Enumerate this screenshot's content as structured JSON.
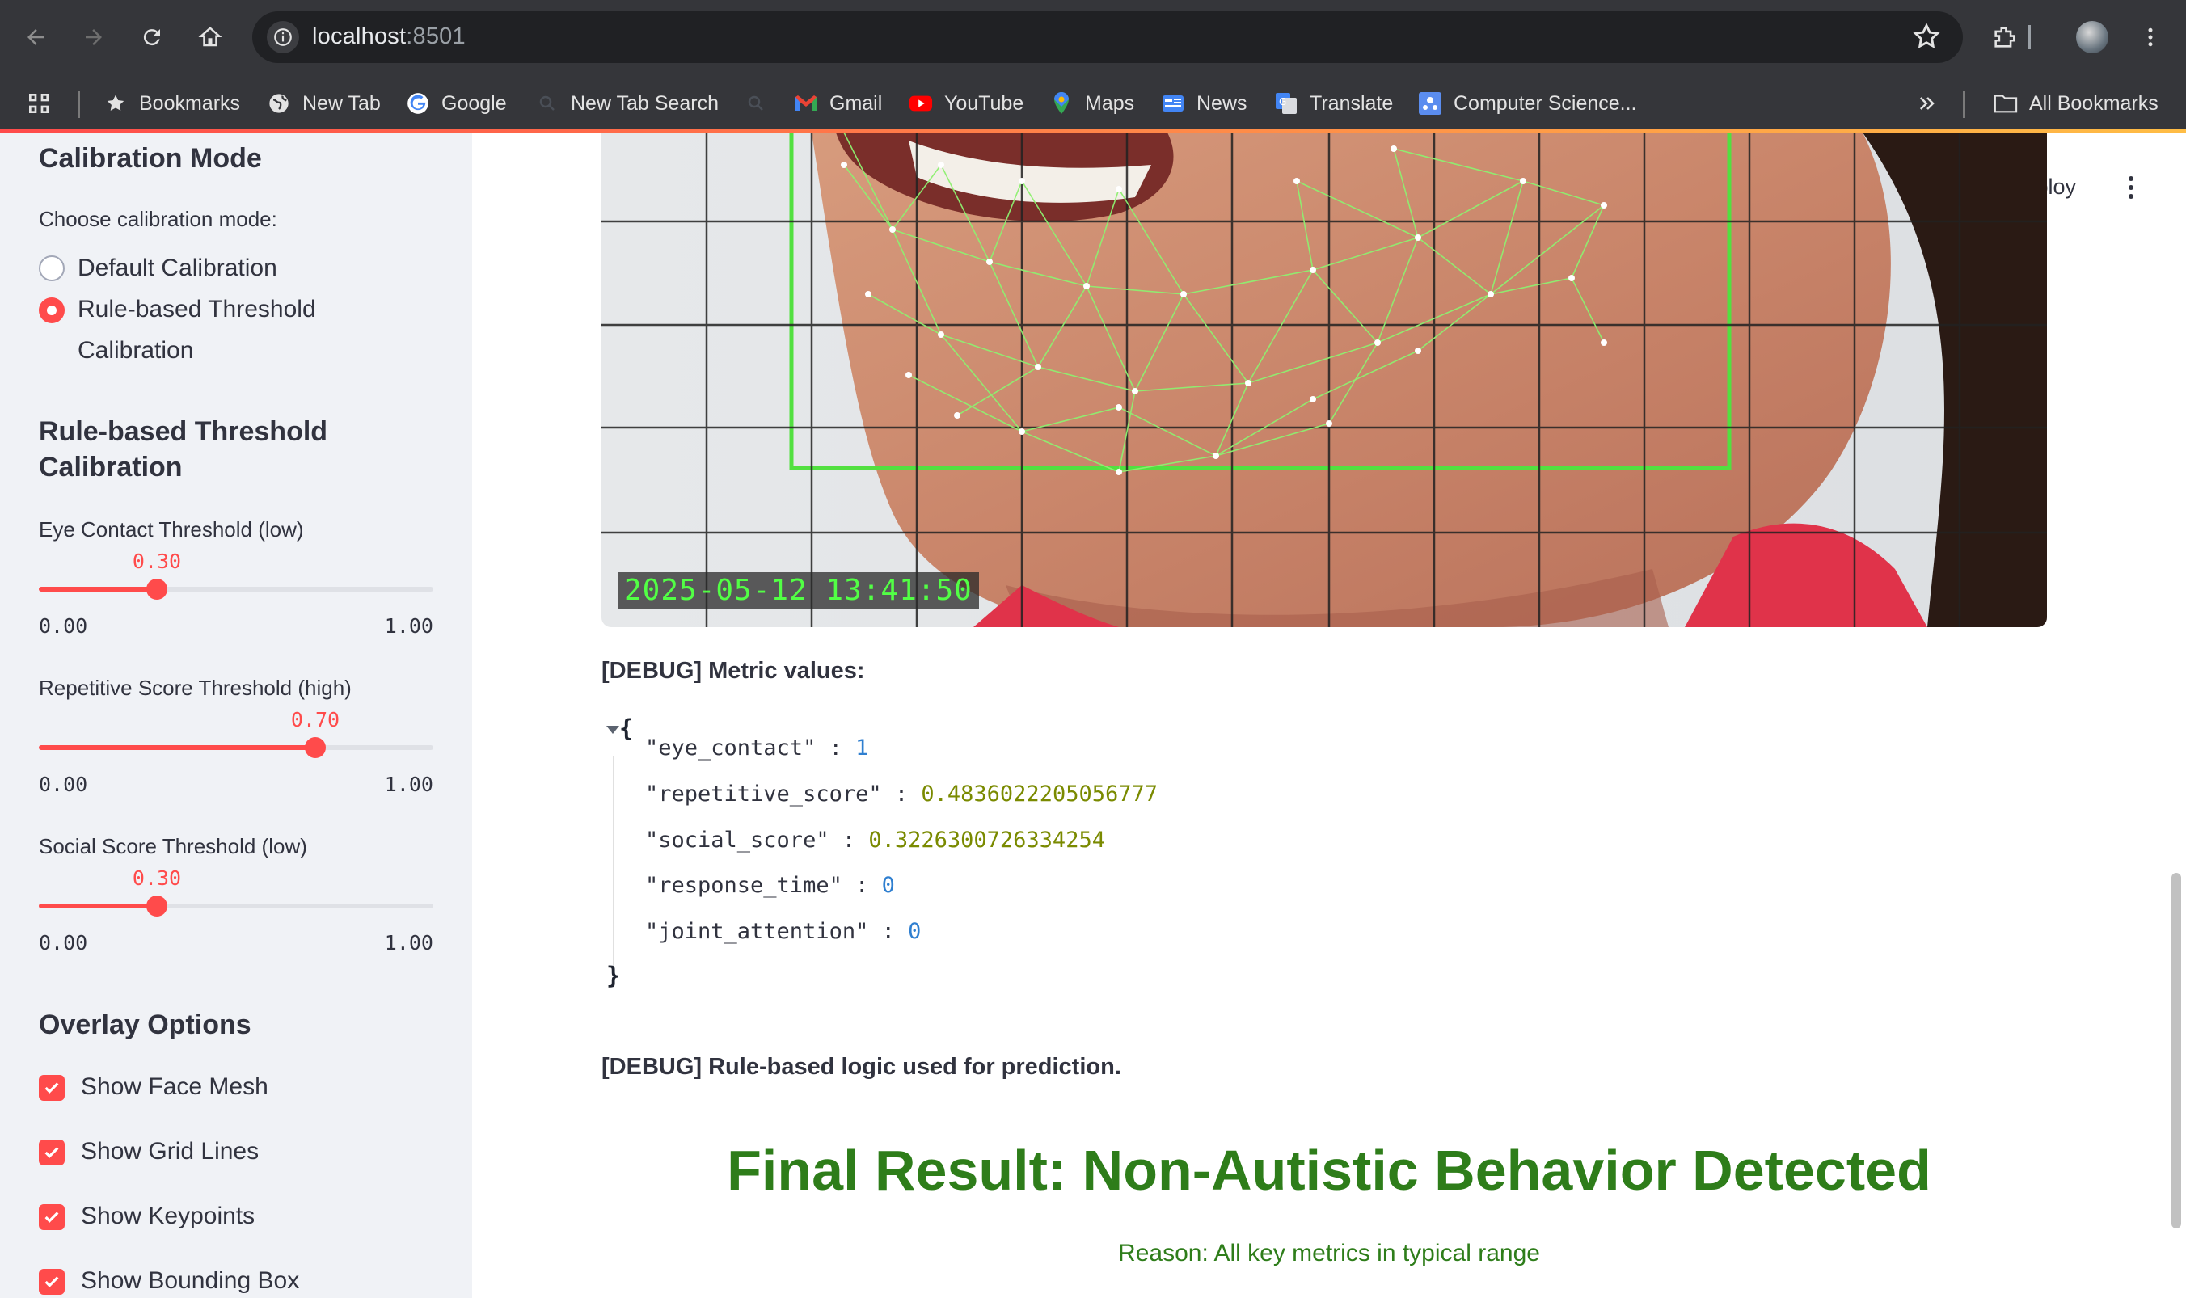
{
  "browser": {
    "url_host": "localhost",
    "url_port": ":8501",
    "bookmarks": [
      {
        "label": "Bookmarks",
        "icon": "star-icon"
      },
      {
        "label": "New Tab",
        "icon": "globe-icon"
      },
      {
        "label": "Google",
        "icon": "google-icon"
      },
      {
        "label": "New Tab Search",
        "icon": "search-icon"
      },
      {
        "label": "Gmail",
        "icon": "gmail-icon"
      },
      {
        "label": "YouTube",
        "icon": "youtube-icon"
      },
      {
        "label": "Maps",
        "icon": "maps-icon"
      },
      {
        "label": "News",
        "icon": "news-icon"
      },
      {
        "label": "Translate",
        "icon": "translate-icon"
      },
      {
        "label": "Computer Science...",
        "icon": "bookmark-site-icon"
      }
    ],
    "all_bookmarks_label": "All Bookmarks"
  },
  "sidebar": {
    "calibration_heading": "Calibration Mode",
    "calibration_prompt": "Choose calibration mode:",
    "calibration_options": [
      {
        "label": "Default Calibration",
        "selected": false
      },
      {
        "label": "Rule-based Threshold",
        "label_line2": "Calibration",
        "selected": true
      }
    ],
    "threshold_heading_line1": "Rule-based Threshold",
    "threshold_heading_line2": "Calibration",
    "sliders": [
      {
        "label": "Eye Contact Threshold (low)",
        "value": 0.3,
        "value_text": "0.30",
        "min_text": "0.00",
        "max_text": "1.00"
      },
      {
        "label": "Repetitive Score Threshold (high)",
        "value": 0.7,
        "value_text": "0.70",
        "min_text": "0.00",
        "max_text": "1.00"
      },
      {
        "label": "Social Score Threshold (low)",
        "value": 0.3,
        "value_text": "0.30",
        "min_text": "0.00",
        "max_text": "1.00"
      }
    ],
    "overlay_heading": "Overlay Options",
    "overlay_options": [
      {
        "label": "Show Face Mesh",
        "checked": true
      },
      {
        "label": "Show Grid Lines",
        "checked": true
      },
      {
        "label": "Show Keypoints",
        "checked": true
      },
      {
        "label": "Show Bounding Box",
        "checked": true
      }
    ]
  },
  "header": {
    "deploy_label": "Deploy"
  },
  "video": {
    "timestamp": "2025-05-12 13:41:50"
  },
  "debug": {
    "metric_label": "[DEBUG] Metric values:",
    "json_open": "{",
    "json_close": "}",
    "metrics": [
      {
        "key": "\"eye_contact\"",
        "value": "1",
        "kind": "int"
      },
      {
        "key": "\"repetitive_score\"",
        "value": "0.4836022205056777",
        "kind": "float"
      },
      {
        "key": "\"social_score\"",
        "value": "0.3226300726334254",
        "kind": "float"
      },
      {
        "key": "\"response_time\"",
        "value": "0",
        "kind": "int"
      },
      {
        "key": "\"joint_attention\"",
        "value": "0",
        "kind": "int"
      }
    ],
    "logic_label": "[DEBUG] Rule-based logic used for prediction."
  },
  "result": {
    "final_text": "Final Result: Non-Autistic Behavior Detected",
    "reason_text": "Reason: All key metrics in typical range",
    "color": "#2e7d1a"
  },
  "theme": {
    "accent": "#ff4b4b",
    "sidebar_bg": "#f0f2f6"
  }
}
